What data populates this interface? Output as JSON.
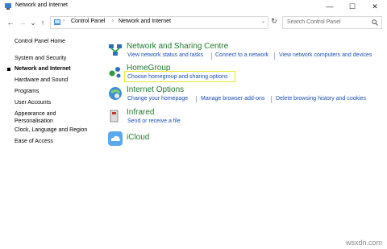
{
  "window": {
    "title": "Network and Internet",
    "controls": {
      "minimize": "—",
      "maximize": "☐",
      "close": "✕"
    }
  },
  "nav": {
    "back": "←",
    "forward": "→",
    "recent": "⌄",
    "up": "↑",
    "refresh": "↻"
  },
  "address": {
    "crumbs": [
      "Control Panel",
      "Network and Internet"
    ],
    "separator": "›",
    "dropdown": "⌄"
  },
  "search": {
    "placeholder": "Search Control Panel"
  },
  "sidebar": {
    "home": "Control Panel Home",
    "items": [
      {
        "label": "System and Security"
      },
      {
        "label": "Network and Internet"
      },
      {
        "label": "Hardware and Sound"
      },
      {
        "label": "Programs"
      },
      {
        "label": "User Accounts"
      },
      {
        "label": "Appearance and\nPersonalisation"
      },
      {
        "label": "Clock, Language and Region"
      },
      {
        "label": "Ease of Access"
      }
    ]
  },
  "categories": [
    {
      "title": "Network and Sharing Centre",
      "icon": "network-sharing-icon",
      "links": [
        "View network status and tasks",
        "Connect to a network",
        "View network computers and devices"
      ]
    },
    {
      "title": "HomeGroup",
      "icon": "homegroup-icon",
      "links": [
        "Choose homegroup and sharing options"
      ]
    },
    {
      "title": "Internet Options",
      "icon": "internet-options-icon",
      "links": [
        "Change your homepage",
        "Manage browser add-ons",
        "Delete browsing history and cookies"
      ]
    },
    {
      "title": "Infrared",
      "icon": "infrared-icon",
      "links": [
        "Send or receive a file"
      ]
    },
    {
      "title": "iCloud",
      "icon": "icloud-icon",
      "links": []
    }
  ],
  "watermark": "wsxdn.com",
  "colors": {
    "link": "#1a4fb3",
    "category_title": "#1e7b2c",
    "highlight": "#e8e82a"
  }
}
